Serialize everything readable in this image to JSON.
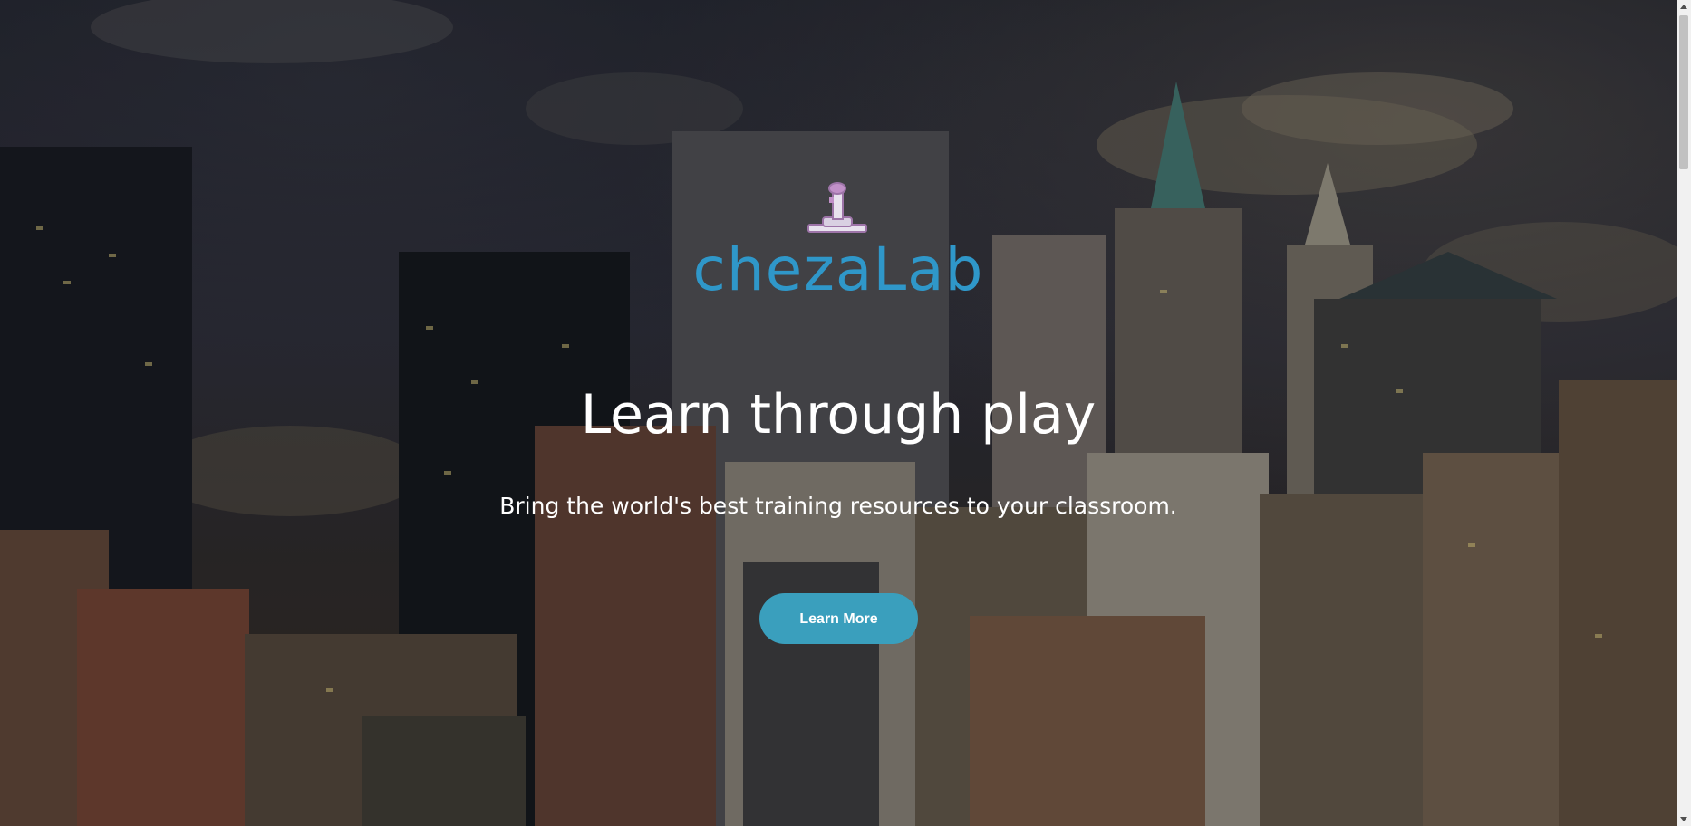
{
  "brand": {
    "name": "chezaLab",
    "logo_icon": "joystick-icon",
    "color": "#2f97c9"
  },
  "hero": {
    "headline": "Learn through play",
    "subheadline": "Bring the world's best training resources to your classroom.",
    "cta_label": "Learn More",
    "cta_color": "#3a9fbd",
    "background": "city-skyline-at-dusk"
  }
}
